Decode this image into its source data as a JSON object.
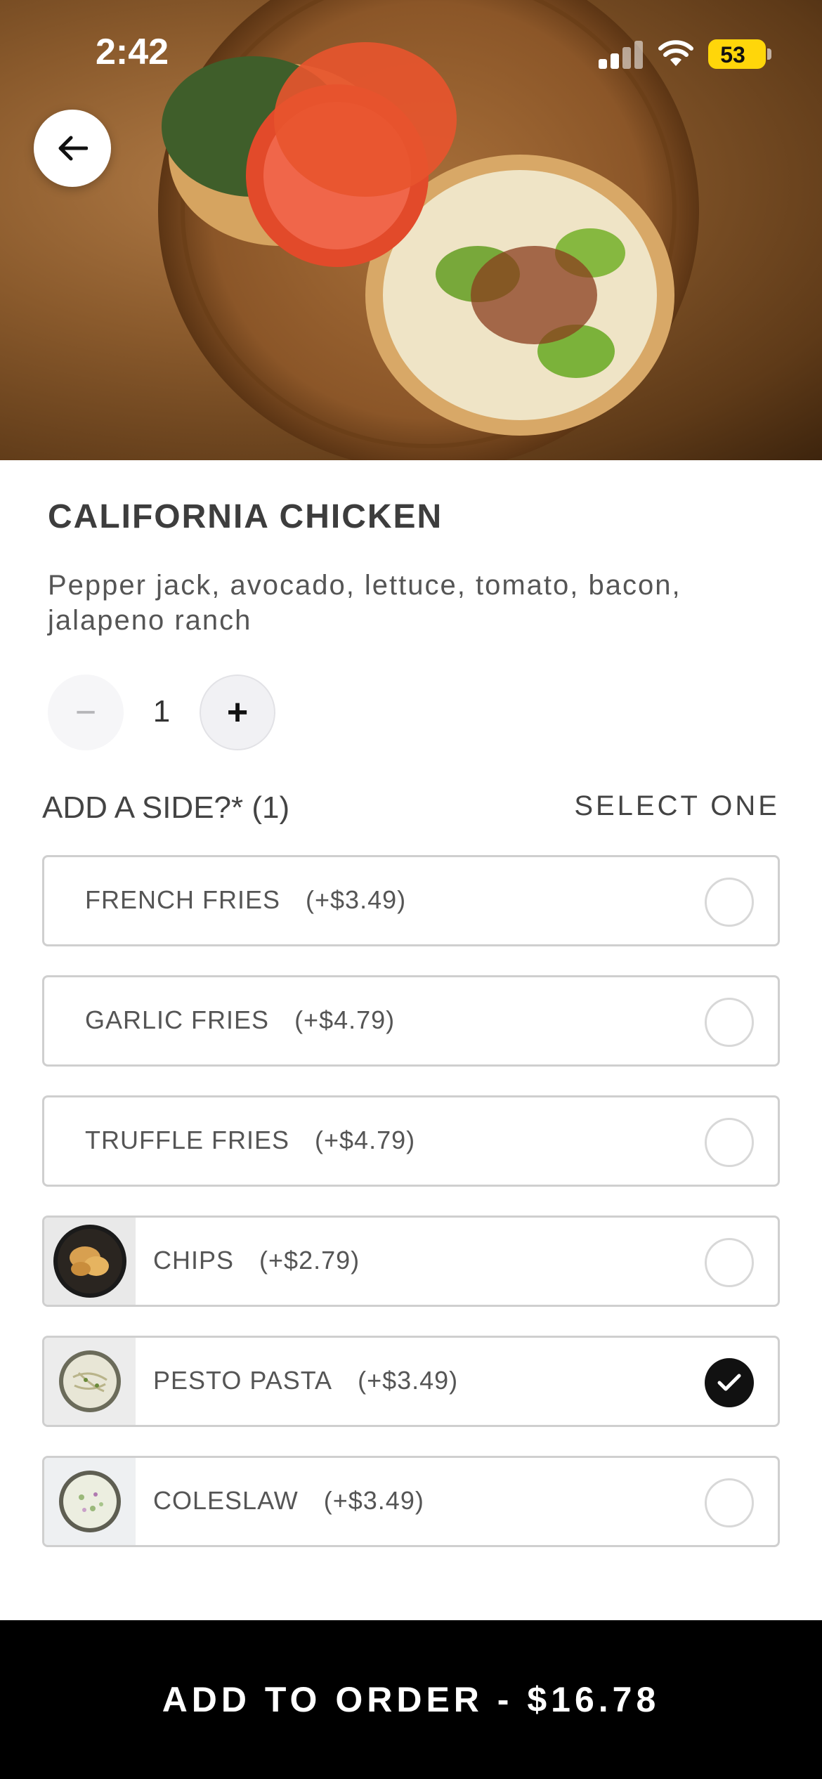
{
  "status_bar": {
    "time": "2:42",
    "battery": "53"
  },
  "item": {
    "title": "CALIFORNIA CHICKEN",
    "description": "Pepper jack, avocado, lettuce, tomato, bacon, jalapeno ranch",
    "quantity": "1",
    "minus_label": "−",
    "plus_label": "+"
  },
  "side_section": {
    "heading": "ADD A SIDE?* (1)",
    "instruction": "SELECT ONE",
    "options": [
      {
        "name": "FRENCH FRIES",
        "price": "(+$3.49)",
        "selected": false,
        "has_thumb": false
      },
      {
        "name": "GARLIC FRIES",
        "price": "(+$4.79)",
        "selected": false,
        "has_thumb": false
      },
      {
        "name": "TRUFFLE FRIES",
        "price": "(+$4.79)",
        "selected": false,
        "has_thumb": false
      },
      {
        "name": "CHIPS",
        "price": "(+$2.79)",
        "selected": false,
        "has_thumb": true
      },
      {
        "name": "PESTO PASTA",
        "price": "(+$3.49)",
        "selected": true,
        "has_thumb": true
      },
      {
        "name": "COLESLAW",
        "price": "(+$3.49)",
        "selected": false,
        "has_thumb": true
      }
    ]
  },
  "cta": {
    "label": "ADD TO ORDER - $16.78"
  },
  "colors": {
    "accent": "#000000",
    "battery": "#ffd60a"
  },
  "icons": {
    "back": "arrow-left-icon",
    "check": "checkmark-icon"
  }
}
